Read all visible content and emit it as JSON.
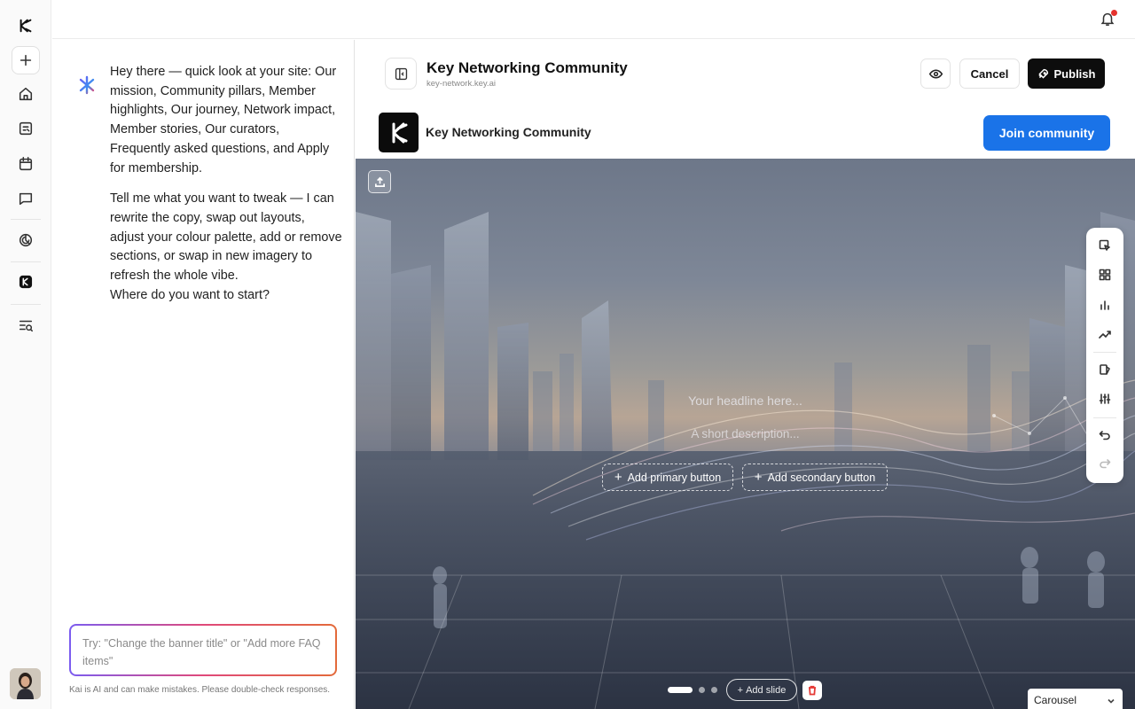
{
  "rail": {
    "logo": "kai-logo-icon",
    "items": [
      {
        "icon": "plus-icon",
        "name": "new"
      },
      {
        "icon": "home-icon",
        "name": "home"
      },
      {
        "icon": "edit-page-icon",
        "name": "pages"
      },
      {
        "icon": "calendar-icon",
        "name": "calendar"
      },
      {
        "icon": "chat-icon",
        "name": "messages"
      },
      {
        "icon": "analytics-icon",
        "name": "analytics"
      },
      {
        "icon": "brand-icon",
        "name": "brand"
      },
      {
        "icon": "search-list-icon",
        "name": "search"
      }
    ]
  },
  "chat": {
    "paragraph1": "Hey there — quick look at your site: Our mission, Community pillars, Member highlights, Our journey, Network impact, Member stories, Our curators, Frequently asked questions, and Apply for membership.",
    "paragraph2": "Tell me what you want to tweak — I can rewrite the copy, swap out layouts, adjust your colour palette, add or remove sections, or swap in new imagery to refresh the whole vibe.",
    "paragraph3": "Where do you want to start?",
    "input_placeholder": "Try: \"Change the banner title\" or \"Add more FAQ items\"",
    "disclaimer": "Kai is AI and can make mistakes. Please double-check responses."
  },
  "editor": {
    "site_title": "Key Networking Community",
    "site_url": "key-network.key.ai",
    "cancel_label": "Cancel",
    "publish_label": "Publish"
  },
  "site_preview": {
    "name": "Key Networking Community",
    "join_label": "Join community",
    "join_color": "#1a73e8",
    "hero": {
      "headline_placeholder": "Your headline here...",
      "description_placeholder": "A short description...",
      "primary_button": "Add primary button",
      "secondary_button": "Add secondary button",
      "add_slide": "Add slide",
      "layout_select": "Carousel",
      "slide_count": 3,
      "active_slide": 1
    }
  },
  "colors": {
    "accent": "#1a73e8",
    "publish_bg": "#0d0d0d",
    "notification_dot": "#e5322d"
  }
}
